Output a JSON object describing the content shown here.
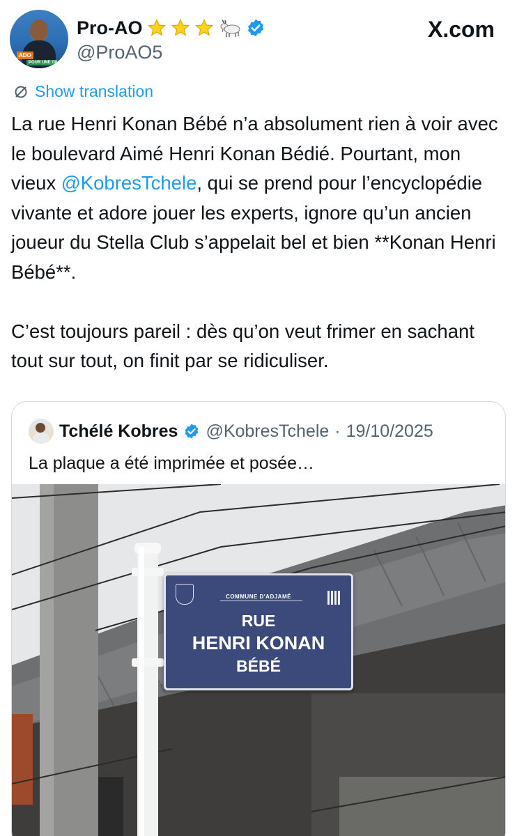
{
  "author": {
    "display_name": "Pro-AO",
    "handle": "@ProAO5",
    "avatar_text": "ADO",
    "avatar_subtext": "POUR UNE GRANDE CÔTE D'IVOIRE",
    "emoji_icons": [
      "star-emoji",
      "star-emoji",
      "star-emoji",
      "goat-emoji"
    ],
    "verified": true
  },
  "watermark": "X.com",
  "translation_link": "Show translation",
  "tweet": {
    "paragraph1_before_mention": "La rue Henri Konan Bébé n’a absolument rien à voir avec le boulevard Aimé Henri Konan Bédié. Pourtant, mon vieux ",
    "mention": "@KobresTchele",
    "paragraph1_after_mention": ", qui se prend pour l’encyclopédie vivante et adore jouer les experts, ignore qu’un ancien joueur du Stella Club s’appelait bel et bien **Konan Henri Bébé**.",
    "paragraph2": "C’est toujours pareil : dès qu’on veut frimer en sachant tout sur tout, on finit par se ridiculiser."
  },
  "quoted": {
    "display_name": "Tchélé Kobres",
    "handle": "@KobresTchele",
    "separator": "·",
    "date": "19/10/2025",
    "text": "La plaque a été imprimée et posée…",
    "verified": true,
    "photo": {
      "sign_commune": "COMMUNE D'ADJAMÉ",
      "sign_line1": "RUE",
      "sign_line2": "HENRI KONAN",
      "sign_line3": "BÉBÉ"
    }
  },
  "colors": {
    "link": "#1d9bf0",
    "text": "#0f1419",
    "secondary": "#536471",
    "border": "#cfd9de",
    "sign": "#3b4a7a"
  }
}
